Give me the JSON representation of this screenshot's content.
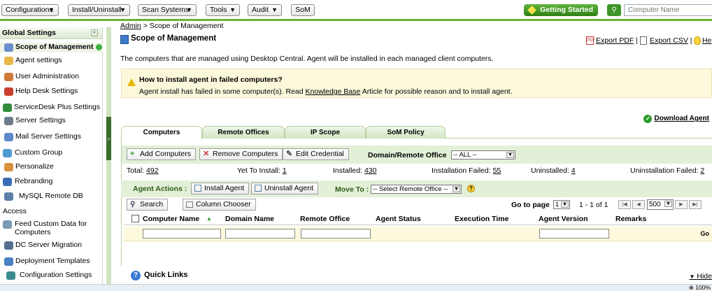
{
  "top_menu": {
    "configurations": "Configurations",
    "install_uninstall": "Install/Uninstall",
    "scan_systems": "Scan Systems",
    "tools": "Tools",
    "audit": "Audit",
    "som": "SoM",
    "getting_started": "Getting Started",
    "search_placeholder": "Computer Name"
  },
  "sidebar": {
    "title": "Global Settings",
    "items": [
      {
        "label": "Scope of Management",
        "icon": "computer-icon",
        "color": "#6a8fcf"
      },
      {
        "label": "Agent settings",
        "icon": "agent-icon",
        "color": "#e8b84a"
      },
      {
        "label": "User Administration",
        "icon": "users-icon",
        "color": "#d07a3c"
      },
      {
        "label": "Help Desk Settings",
        "icon": "helpdesk-icon",
        "color": "#c84030"
      },
      {
        "label": "ServiceDesk Plus Settings",
        "icon": "servicedesk-icon",
        "color": "#2f8d3c"
      },
      {
        "label": "Server Settings",
        "icon": "server-icon",
        "color": "#6d7b8a"
      },
      {
        "label": "Mail Server Settings",
        "icon": "mail-icon",
        "color": "#5a88c9"
      },
      {
        "label": "Custom Group",
        "icon": "group-icon",
        "color": "#4f9bd3"
      },
      {
        "label": "Personalize",
        "icon": "personalize-icon",
        "color": "#d8913d"
      },
      {
        "label": "Rebranding",
        "icon": "rebranding-icon",
        "color": "#3a6cb7"
      },
      {
        "label": "MySQL Remote DB",
        "icon": "database-icon",
        "color": "#5b7fa8"
      },
      {
        "label": "Feed Custom Data for Computers",
        "icon": "feed-icon",
        "color": "#7a9bb8"
      },
      {
        "label": "DC Server Migration",
        "icon": "migration-icon",
        "color": "#556f8e"
      },
      {
        "label": "Deployment Templates",
        "icon": "templates-icon",
        "color": "#4a80c5"
      },
      {
        "label": "Configuration Settings",
        "icon": "config-icon",
        "color": "#3a8c8f"
      }
    ],
    "mysql_tail": "Access"
  },
  "breadcrumb": {
    "root": "Admin",
    "sep": ">",
    "current": "Scope of Management"
  },
  "page": {
    "title": "Scope of Management",
    "export_pdf": "Export PDF",
    "export_csv": "Export CSV",
    "help": "He",
    "description": "The computers that are managed using Desktop Central. Agent will be installed in each managed client computers."
  },
  "warning": {
    "title": "How to install agent in failed computers?",
    "text_before": "Agent install has failed in some computer(s). Read",
    "link": "Knowledge Base",
    "text_after": "Article for possible reason and to install agent."
  },
  "download_agent": "Download Agent",
  "tabs": [
    "Computers",
    "Remote Offices",
    "IP Scope",
    "SoM Policy"
  ],
  "toolbar": {
    "add": "Add Computers",
    "remove": "Remove Computers",
    "edit": "Edit Credential",
    "domain_label": "Domain/Remote Office",
    "domain_value": "-- ALL --"
  },
  "stats": [
    {
      "label": "Total:",
      "value": "492"
    },
    {
      "label": "Yet To Install:",
      "value": "1"
    },
    {
      "label": "Installed:",
      "value": "430"
    },
    {
      "label": "Installation Failed:",
      "value": "55"
    },
    {
      "label": "Uninstalled:",
      "value": "4"
    },
    {
      "label": "Uninstallation Failed:",
      "value": "2"
    }
  ],
  "agent_actions": {
    "label": "Agent Actions :",
    "install": "Install Agent",
    "uninstall": "Uninstall Agent",
    "move_to": "Move To :",
    "move_value": "-- Select Remote Office --"
  },
  "list_tools": {
    "search": "Search",
    "column_chooser": "Column Chooser",
    "go_to_page": "Go to page",
    "page_value": "1",
    "range": "1 - 1 of 1",
    "per_page": "500"
  },
  "columns": [
    "Computer Name",
    "Domain Name",
    "Remote Office",
    "Agent Status",
    "Execution Time",
    "Agent Version",
    "Remarks"
  ],
  "filter_go": "Go",
  "quick_links": {
    "title": "Quick Links",
    "hide": "Hide"
  },
  "status_bar": {
    "zoom": "100%"
  },
  "colors": {
    "accent_green": "#69b531",
    "warning_bg": "#fbf8dc",
    "toolbar_bg": "#e3f0d8"
  }
}
